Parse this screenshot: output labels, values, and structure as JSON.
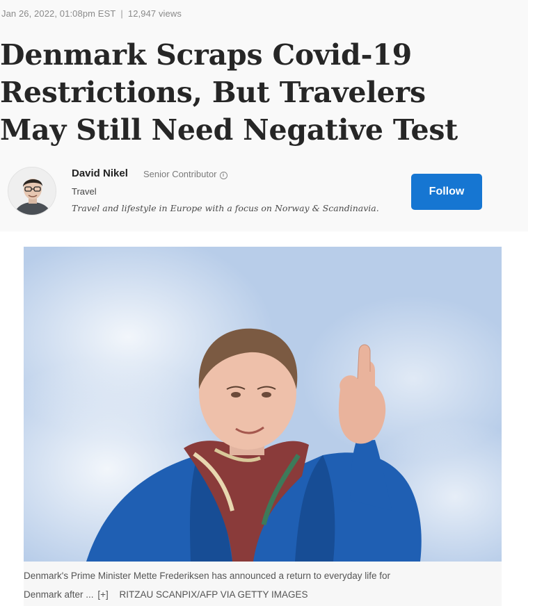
{
  "article": {
    "date": "Jan 26, 2022, 01:08pm EST",
    "separator": "|",
    "views": "12,947 views",
    "headline_lines": [
      "Denmark Scraps Covid-19",
      "Restrictions, But Travelers",
      "May Still Need Negative Test"
    ]
  },
  "author": {
    "name": "David Nikel",
    "role": "Senior Contributor",
    "info_icon": "info-circle-icon",
    "section": "Travel",
    "bio": "Travel and lifestyle in Europe with a focus on Norway & Scandinavia.",
    "follow_label": "Follow",
    "follow_color": "#1676d2"
  },
  "image": {
    "caption_line1": "Denmark's Prime Minister Mette Frederiksen has announced a return to everyday life for",
    "caption_line2": "Denmark after ...",
    "expand_label": "[+]",
    "credit": "RITZAU SCANPIX/AFP VIA GETTY IMAGES"
  }
}
